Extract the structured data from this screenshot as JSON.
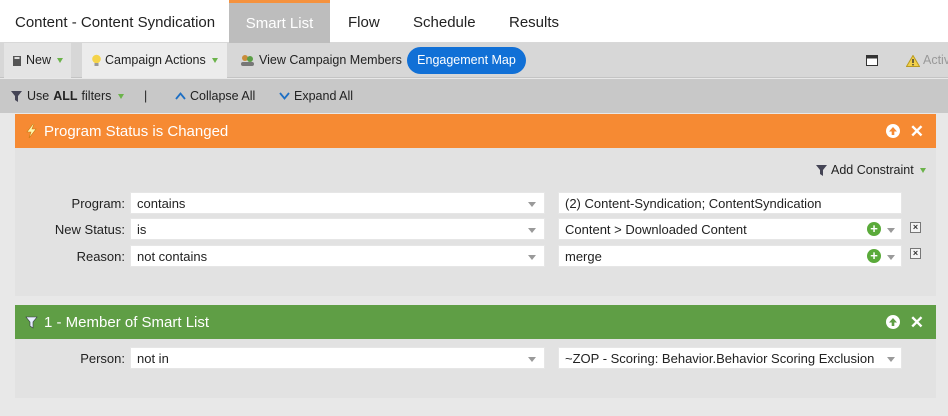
{
  "tabs": {
    "title": "Content - Content Syndication",
    "items": [
      "Smart List",
      "Flow",
      "Schedule",
      "Results"
    ],
    "active": "Smart List"
  },
  "toolbar1": {
    "new_label": "New",
    "campaign_actions_label": "Campaign Actions",
    "view_members_label": "View Campaign Members",
    "engagement_map_label": "Engagement Map",
    "active_label": "Activ"
  },
  "toolbar2": {
    "use_prefix": "Use",
    "use_all": "ALL",
    "use_suffix": "filters",
    "separator": "|",
    "collapse_all": "Collapse All",
    "expand_all": "Expand All"
  },
  "filter1": {
    "title": "Program Status is Changed",
    "add_constraint_label": "Add Constraint",
    "rows": [
      {
        "label": "Program:",
        "operator": "contains",
        "value": "(2) Content-Syndication; ContentSyndication"
      },
      {
        "label": "New Status:",
        "operator": "is",
        "value": "Content > Downloaded Content"
      },
      {
        "label": "Reason:",
        "operator": "not contains",
        "value": "merge"
      }
    ]
  },
  "filter2": {
    "title": "1 - Member of Smart List",
    "rows": [
      {
        "label": "Person:",
        "operator": "not in",
        "value": "~ZOP - Scoring: Behavior.Behavior Scoring Exclusion"
      }
    ]
  },
  "colors": {
    "orange_header": "#f68a33",
    "green_header": "#5f9e45",
    "accent_blue": "#1170d6",
    "active_tab": "#bdbdbd"
  }
}
